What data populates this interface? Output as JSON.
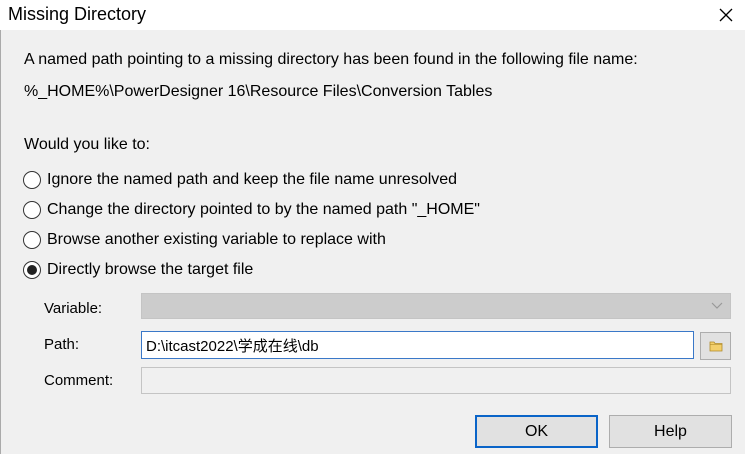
{
  "window": {
    "title": "Missing Directory"
  },
  "message": {
    "line1": "A named path pointing to a missing directory has been found in the following file name:",
    "file_name": "%_HOME%\\PowerDesigner 16\\Resource Files\\Conversion Tables"
  },
  "question": "Would you like to:",
  "options": [
    {
      "label": "Ignore the named path and keep the file name unresolved",
      "checked": false
    },
    {
      "label": "Change the directory pointed to by the named path \"_HOME\"",
      "checked": false
    },
    {
      "label": "Browse another existing variable to replace with",
      "checked": false
    },
    {
      "label": "Directly browse the target file",
      "checked": true
    }
  ],
  "fields": {
    "variable_label": "Variable:",
    "variable_value": "",
    "path_label": "Path:",
    "path_value": "D:\\itcast2022\\学成在线\\db",
    "comment_label": "Comment:",
    "comment_value": ""
  },
  "buttons": {
    "ok": "OK",
    "help": "Help"
  },
  "icons": {
    "close": "close-icon",
    "dropdown": "chevron-down-icon",
    "browse": "folder-icon"
  },
  "colors": {
    "accent": "#0a64c8",
    "input_focus_border": "#3a78c8",
    "dialog_bg": "#f0f0f0"
  }
}
